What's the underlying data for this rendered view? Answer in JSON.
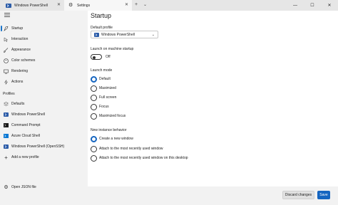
{
  "tabs": [
    {
      "label": "Windows PowerShell",
      "icon": "powershell-icon"
    },
    {
      "label": "Settings",
      "icon": "gear-icon"
    }
  ],
  "sidebar": {
    "items": [
      {
        "label": "Startup",
        "icon": "rocket-icon"
      },
      {
        "label": "Interaction",
        "icon": "cursor-icon"
      },
      {
        "label": "Appearance",
        "icon": "paint-brush-icon"
      },
      {
        "label": "Color schemes",
        "icon": "palette-icon"
      },
      {
        "label": "Rendering",
        "icon": "monitor-icon"
      },
      {
        "label": "Actions",
        "icon": "lightning-icon"
      }
    ],
    "profiles_heading": "Profiles",
    "profiles": [
      {
        "label": "Defaults",
        "icon": "layers-icon"
      },
      {
        "label": "Windows PowerShell",
        "icon": "powershell-icon"
      },
      {
        "label": "Command Prompt",
        "icon": "cmd-icon"
      },
      {
        "label": "Azure Cloud Shell",
        "icon": "azure-icon"
      },
      {
        "label": "Windows PowerShell (OpenSSH)",
        "icon": "powershell-icon"
      },
      {
        "label": "Add a new profile",
        "icon": "plus-icon"
      }
    ],
    "open_json": "Open JSON file"
  },
  "main": {
    "title": "Startup",
    "default_profile_label": "Default profile",
    "default_profile_value": "Windows PowerShell",
    "launch_startup_label": "Launch on machine startup",
    "launch_startup_state": "Off",
    "launch_mode_label": "Launch mode",
    "launch_modes": [
      "Default",
      "Maximized",
      "Full screen",
      "Focus",
      "Maximized focus"
    ],
    "new_instance_label": "New instance behavior",
    "new_instance_options": [
      "Create a new window",
      "Attach to the most recently used window",
      "Attach to the most recently used window on this desktop"
    ]
  },
  "footer": {
    "discard": "Discard changes",
    "save": "Save"
  },
  "colors": {
    "accent": "#1565c0",
    "sidebar_bg": "#f2f2f2",
    "tabbar_bg": "#e6e6e6"
  }
}
